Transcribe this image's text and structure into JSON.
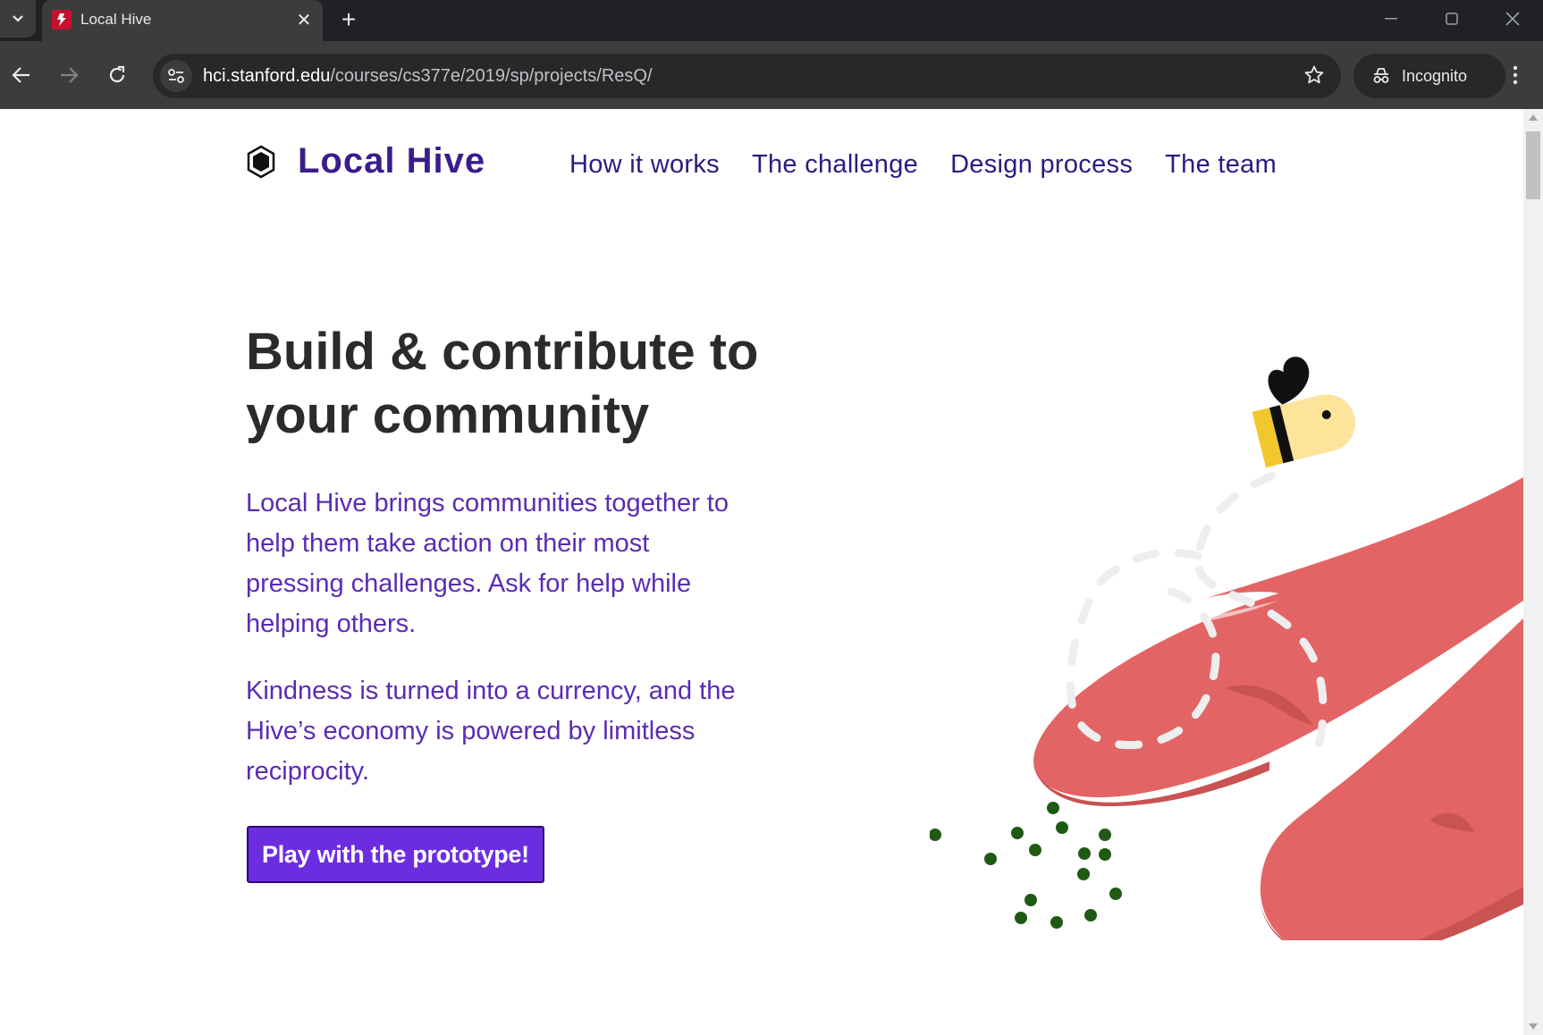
{
  "browser": {
    "tab_title": "Local Hive",
    "tab_close": "✕",
    "new_tab": "+",
    "url_host": "hci.stanford.edu",
    "url_path": "/courses/cs377e/2019/sp/projects/ResQ/",
    "incognito_label": "Incognito"
  },
  "site": {
    "brand_name": "Local Hive",
    "nav": [
      "How it works",
      "The challenge",
      "Design process",
      "The team"
    ]
  },
  "hero": {
    "title_line1": "Build & contribute to",
    "title_line2": "your community",
    "paragraph1": "Local Hive brings communities together to help them take action on their most pressing challenges. Ask for help while helping others.",
    "paragraph2": "Kindness is turned into a currency, and the Hive’s economy is powered by limitless reciprocity.",
    "cta_label": "Play with the prototype!"
  },
  "colors": {
    "brand_purple": "#3b1c8c",
    "body_purple": "#5b2bb5",
    "cta_purple": "#6c2de0",
    "hand_red": "#e36464",
    "seed_green": "#1f5a14",
    "bee_yellow": "#f2c72d"
  }
}
